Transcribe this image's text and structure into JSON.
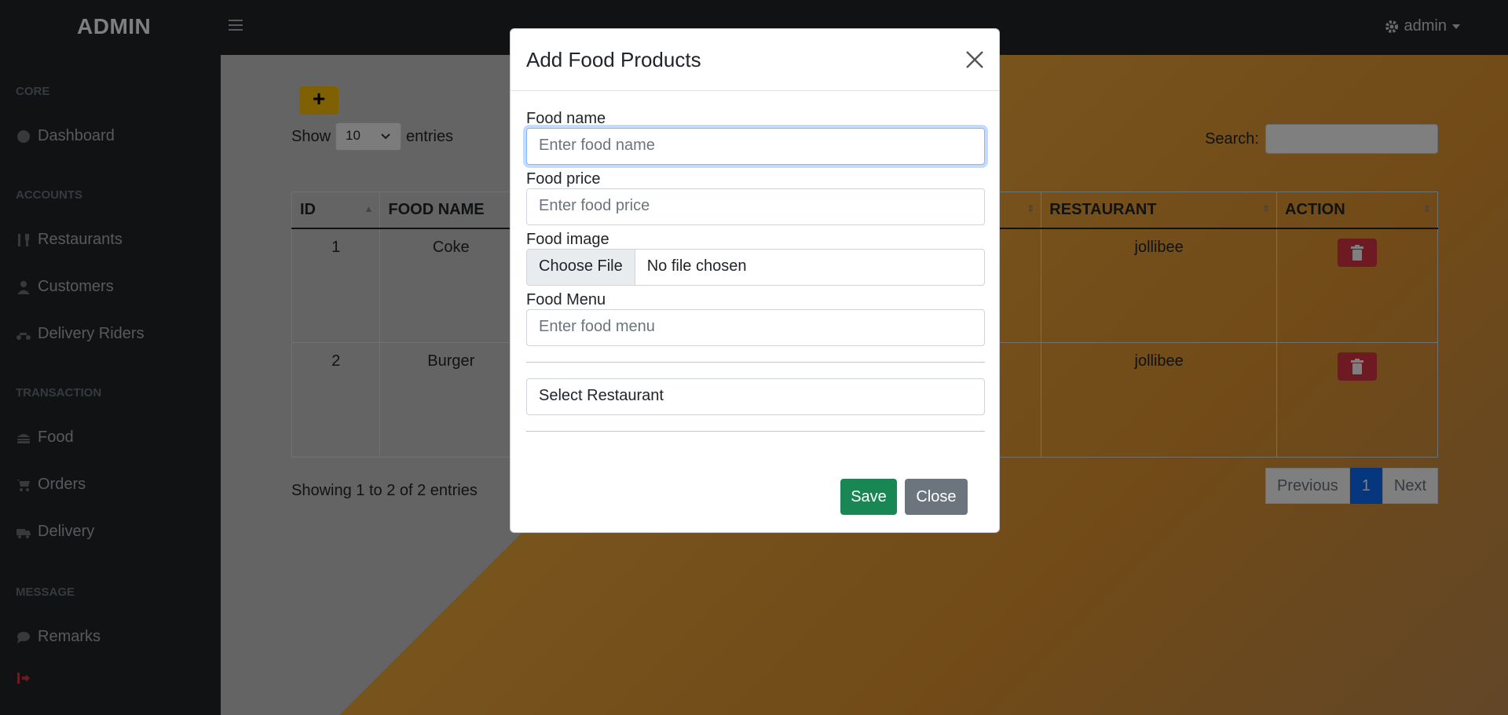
{
  "brand": "ADMIN",
  "user_menu": {
    "label": "admin"
  },
  "sidebar": {
    "sections": [
      {
        "heading": "CORE",
        "items": [
          {
            "label": "Dashboard",
            "icon": "dashboard-icon"
          }
        ]
      },
      {
        "heading": "ACCOUNTS",
        "items": [
          {
            "label": "Restaurants",
            "icon": "utensils-icon"
          },
          {
            "label": "Customers",
            "icon": "user-icon"
          },
          {
            "label": "Delivery Riders",
            "icon": "motorcycle-icon"
          }
        ]
      },
      {
        "heading": "TRANSACTION",
        "items": [
          {
            "label": "Food",
            "icon": "burger-icon"
          },
          {
            "label": "Orders",
            "icon": "cart-icon"
          },
          {
            "label": "Delivery",
            "icon": "truck-icon"
          }
        ]
      },
      {
        "heading": "MESSAGE",
        "items": [
          {
            "label": "Remarks",
            "icon": "comment-icon"
          }
        ]
      }
    ],
    "logout_icon": "sign-out-icon"
  },
  "main": {
    "add_label": "+",
    "show_label": "Show",
    "entries_label": "entries",
    "page_size": "10",
    "search_label": "Search:",
    "table": {
      "headers": [
        "ID",
        "FOOD NAME",
        "RESTAURANT",
        "ACTION"
      ],
      "rows": [
        {
          "id": "1",
          "name": "Coke",
          "restaurant": "jollibee"
        },
        {
          "id": "2",
          "name": "Burger",
          "restaurant": "jollibee"
        }
      ]
    },
    "info": "Showing 1 to 2 of 2 entries",
    "pager": {
      "previous": "Previous",
      "current": "1",
      "next": "Next"
    }
  },
  "modal": {
    "title": "Add Food Products",
    "fields": {
      "name_label": "Food name",
      "name_placeholder": "Enter food name",
      "price_label": "Food price",
      "price_placeholder": "Enter food price",
      "image_label": "Food image",
      "file_button": "Choose File",
      "file_status": "No file chosen",
      "menu_label": "Food Menu",
      "menu_placeholder": "Enter food menu",
      "restaurant_select": "Select Restaurant"
    },
    "save_label": "Save",
    "close_label": "Close"
  },
  "colors": {
    "sidebar_bg": "#212529",
    "accent_yellow": "#ffc107",
    "danger": "#dc3545",
    "success": "#198754",
    "primary": "#0d6efd"
  }
}
